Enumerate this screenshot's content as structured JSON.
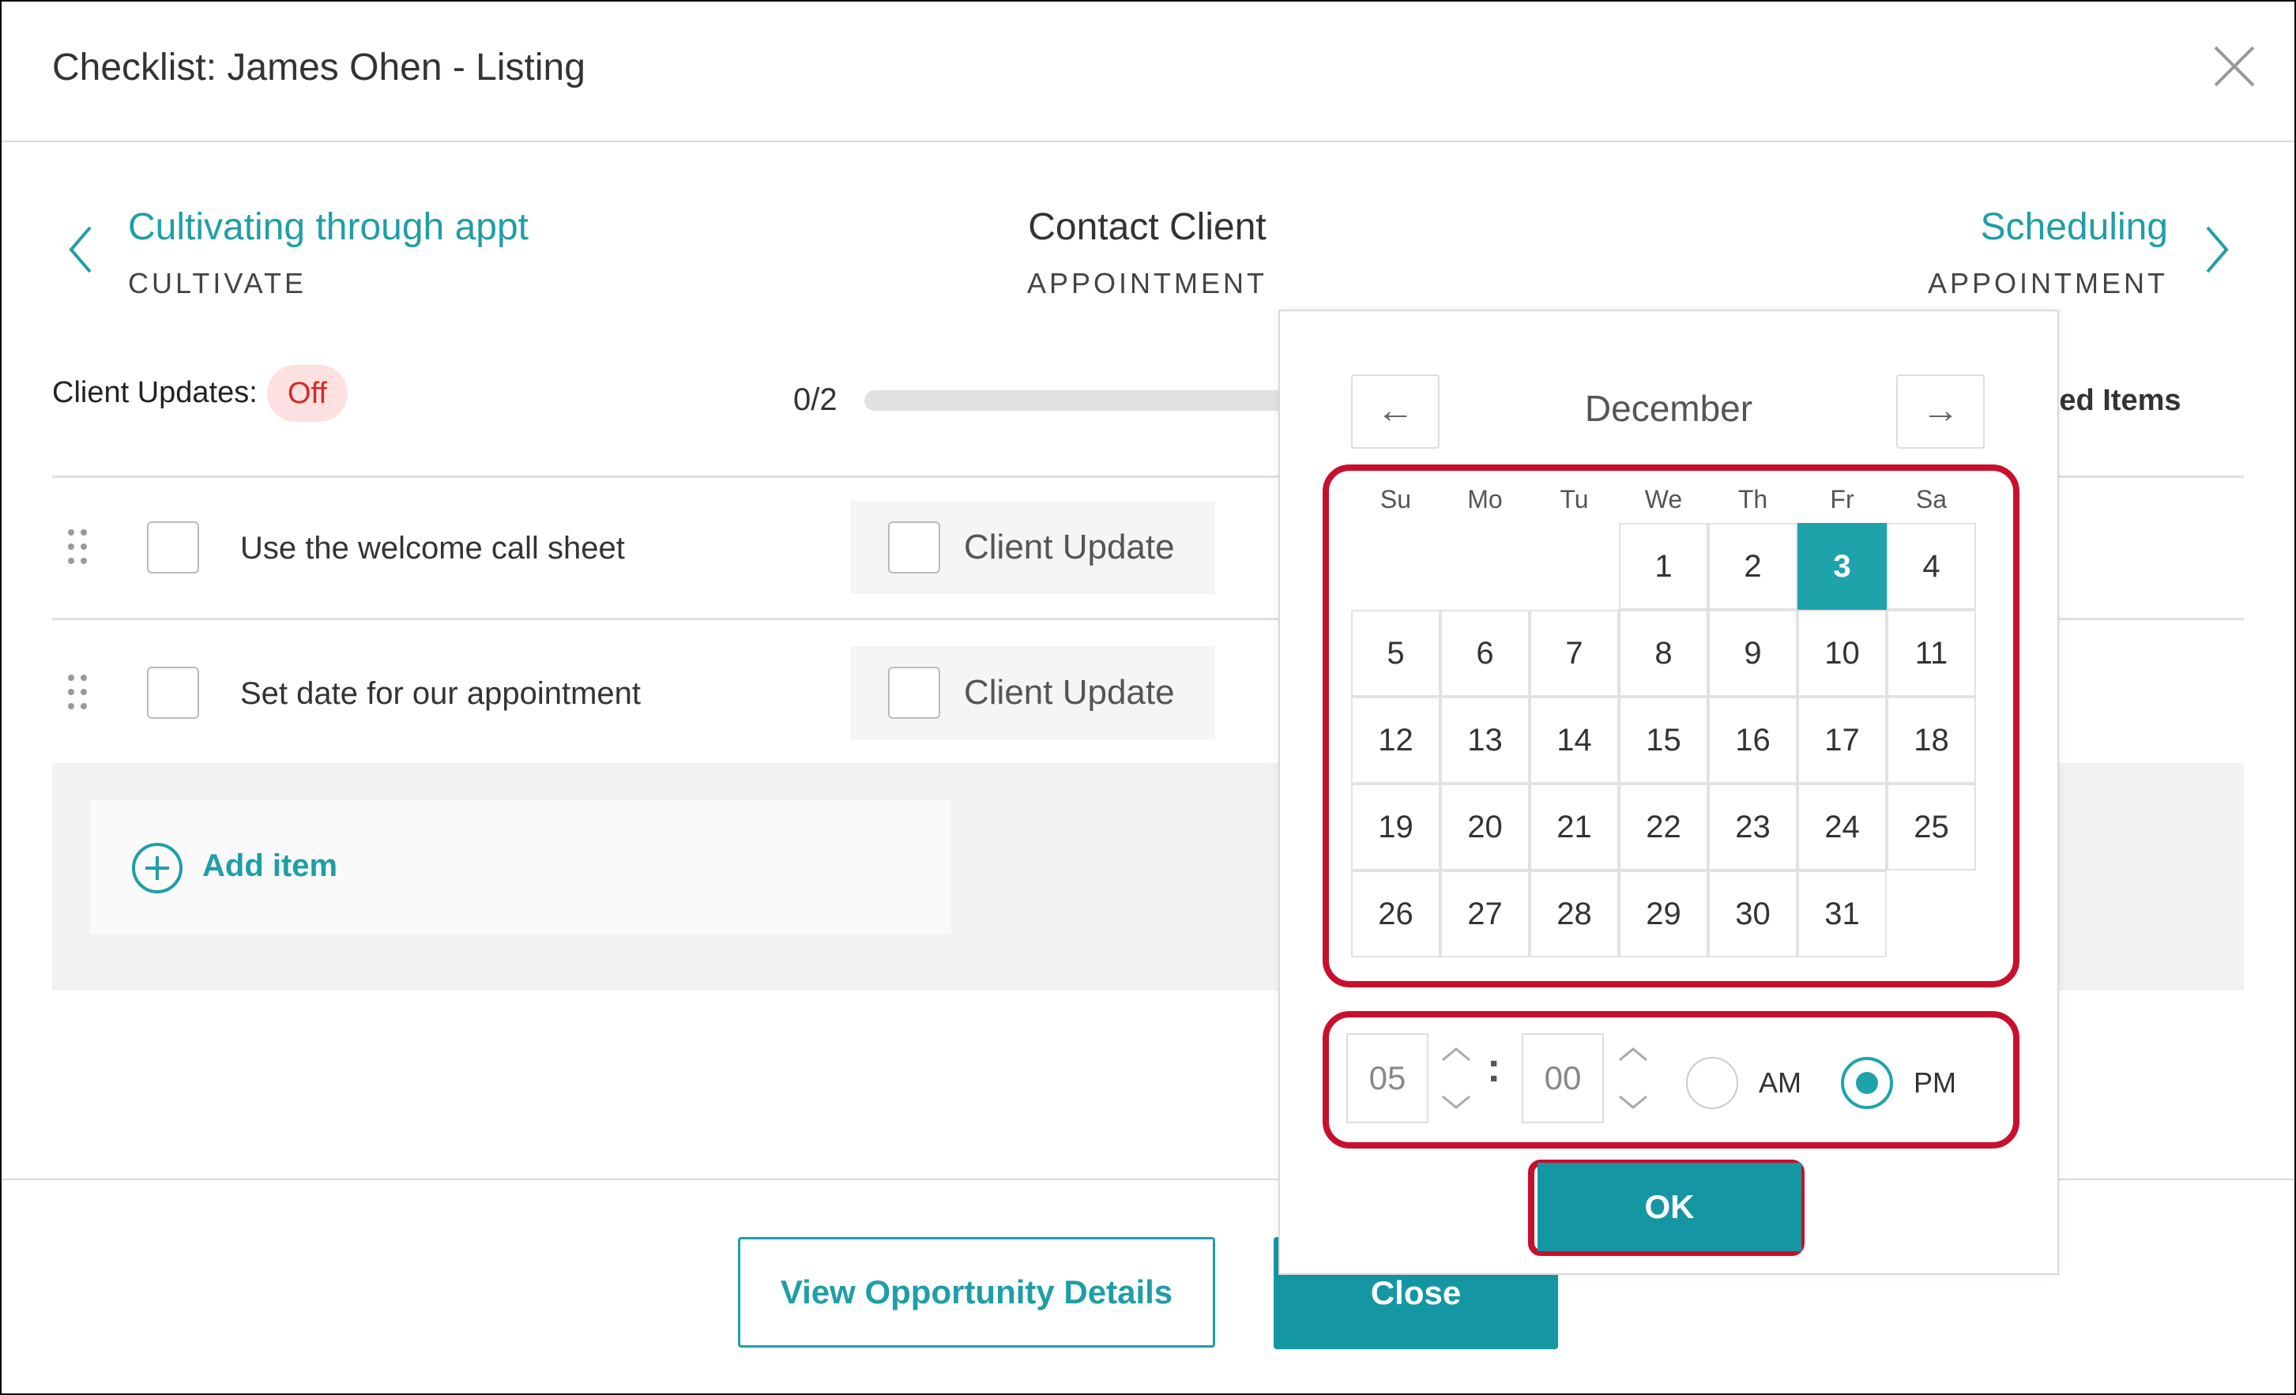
{
  "dialog": {
    "title": "Checklist: James Ohen - Listing"
  },
  "stages": {
    "previous": {
      "name": "Cultivating through appt",
      "category": "CULTIVATE"
    },
    "current": {
      "name": "Contact Client",
      "category": "APPOINTMENT"
    },
    "next": {
      "name": "Scheduling",
      "category": "APPOINTMENT"
    }
  },
  "client_updates": {
    "label": "Client Updates:",
    "status": "Off"
  },
  "progress": {
    "text": "0/2",
    "fraction": 0.0
  },
  "completed_items_label": "leted Items",
  "items": [
    {
      "text": "Use the welcome call sheet",
      "client_update_label": "Client Update"
    },
    {
      "text": "Set date for our appointment",
      "client_update_label": "Client Update"
    }
  ],
  "add_item_label": "Add item",
  "footer": {
    "view_details_label": "View Opportunity Details",
    "close_label": "Close"
  },
  "datepicker": {
    "month": "December",
    "prev_arrow": "←",
    "next_arrow": "→",
    "weekdays": [
      "Su",
      "Mo",
      "Tu",
      "We",
      "Th",
      "Fr",
      "Sa"
    ],
    "selected_day": 3,
    "first_weekday_index": 3,
    "days_in_month": 31,
    "hour": "05",
    "minute": "00",
    "time_separator": ":",
    "am_label": "AM",
    "pm_label": "PM",
    "period": "PM",
    "ok_label": "OK"
  },
  "colors": {
    "accent": "#1f9ea6",
    "button": "#1497a3",
    "highlight_red": "#c8102e",
    "off_pill_bg": "#fde0e0",
    "off_pill_text": "#d62828"
  }
}
